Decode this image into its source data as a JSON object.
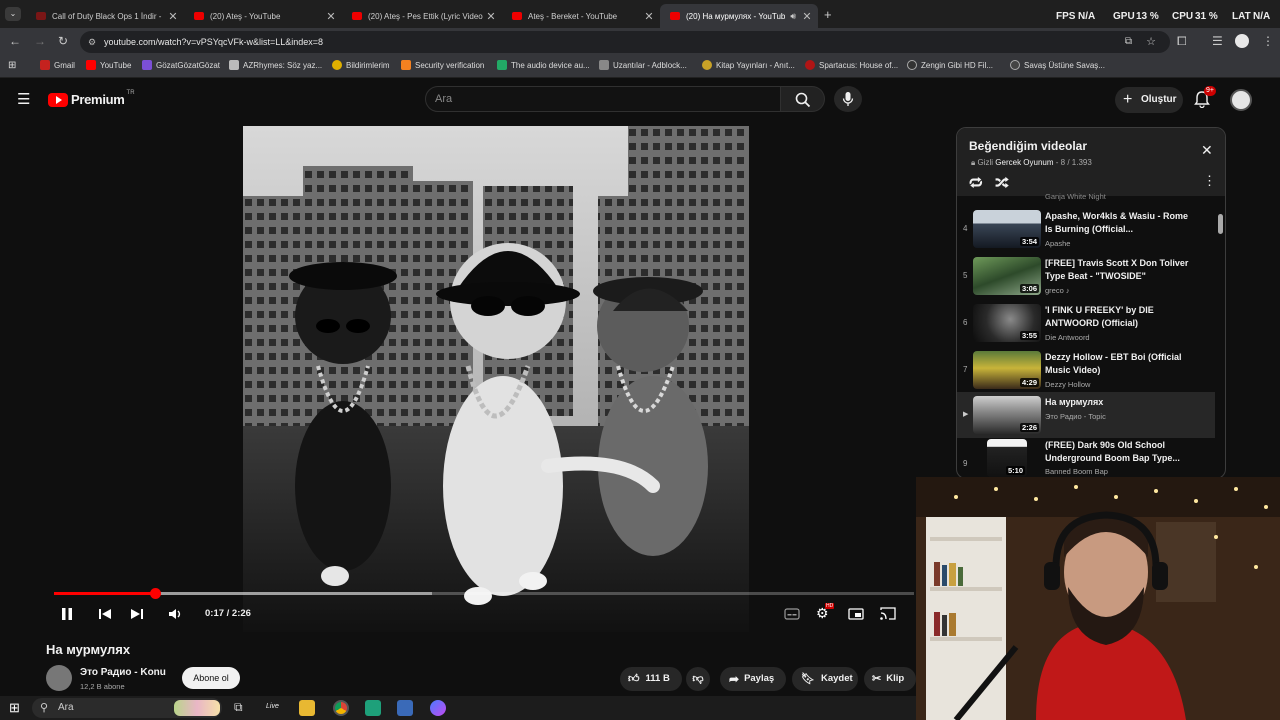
{
  "tabs": [
    {
      "label": "Call of Duty Black Ops 1 İndir -",
      "active": false
    },
    {
      "label": "(20) Ateş - YouTube",
      "active": false
    },
    {
      "label": "(20) Ateş - Pes Ettik (Lyric Video",
      "active": false
    },
    {
      "label": "Ateş - Bereket - YouTube",
      "active": false
    },
    {
      "label": "(20) На мурмулях - YouTub",
      "active": true
    }
  ],
  "new_tab": "+",
  "stats": {
    "fps": "FPS",
    "fps_val": "N/A",
    "gpu": "GPU",
    "gpu_val": "13 %",
    "cpu": "CPU",
    "cpu_val": "31 %",
    "lat": "LAT",
    "lat_val": "N/A"
  },
  "address": {
    "url": "youtube.com/watch?v=vPSYqcVFk-w&list=LL&index=8"
  },
  "bookmarks": [
    "Gmail",
    "YouTube",
    "GözatGözatGözat",
    "AZRhymes: Söz yaz...",
    "Bildirimlerim",
    "Security verification",
    "The audio device au...",
    "Uzantılar - Adblock...",
    "Kitap Yayınları - Anıt...",
    "Spartacus: House of...",
    "Zengin Gibi HD Fil...",
    "Savaş Üstüne Savaş..."
  ],
  "yt": {
    "logo": "Premium",
    "region": "TR",
    "search_placeholder": "Ara",
    "create": "Oluştur",
    "notif_count": "9+"
  },
  "player": {
    "time": "0:17 / 2:26",
    "played_fraction": 0.117,
    "buffered_fraction": 0.44,
    "hd_badge": "HD"
  },
  "video": {
    "title": "На мурмулях",
    "channel": "Это Радио - Konu",
    "subs": "12,2 B abone",
    "subscribe": "Abone ol",
    "likes": "111 B",
    "share": "Paylaş",
    "save": "Kaydet",
    "clip": "Klip"
  },
  "playlist": {
    "title": "Beğendiğim videolar",
    "privacy": "Gizli",
    "owner": "Gercek Oyunum",
    "position": "- 8 / 1.393",
    "partial_top_channel": "Ganja White Night",
    "items": [
      {
        "index": "4",
        "title": "Apashe, Wor4kls & Wasiu - Rome Is Burning (Official...",
        "channel": "Apashe",
        "duration": "3:54"
      },
      {
        "index": "5",
        "title": "[FREE] Travis Scott X Don Toliver Type Beat - \"TWOSIDE\"",
        "channel": "greco ♪",
        "duration": "3:06"
      },
      {
        "index": "6",
        "title": "'I FINK U FREEKY' by DIE ANTWOORD (Official)",
        "channel": "Die Antwoord",
        "duration": "3:55"
      },
      {
        "index": "7",
        "title": "Dezzy Hollow - EBT Boi (Official Music Video)",
        "channel": "Dezzy Hollow",
        "duration": "4:29"
      },
      {
        "index": "▶",
        "title": "На мурмулях",
        "channel": "Это Радио - Topic",
        "duration": "2:26",
        "current": true
      },
      {
        "index": "9",
        "title": "(FREE) Dark 90s Old School Underground Boom Bap Type...",
        "channel": "Banned Boom Bap",
        "duration": "5:10"
      }
    ]
  },
  "taskbar": {
    "search": "Ara",
    "live": "Live"
  }
}
